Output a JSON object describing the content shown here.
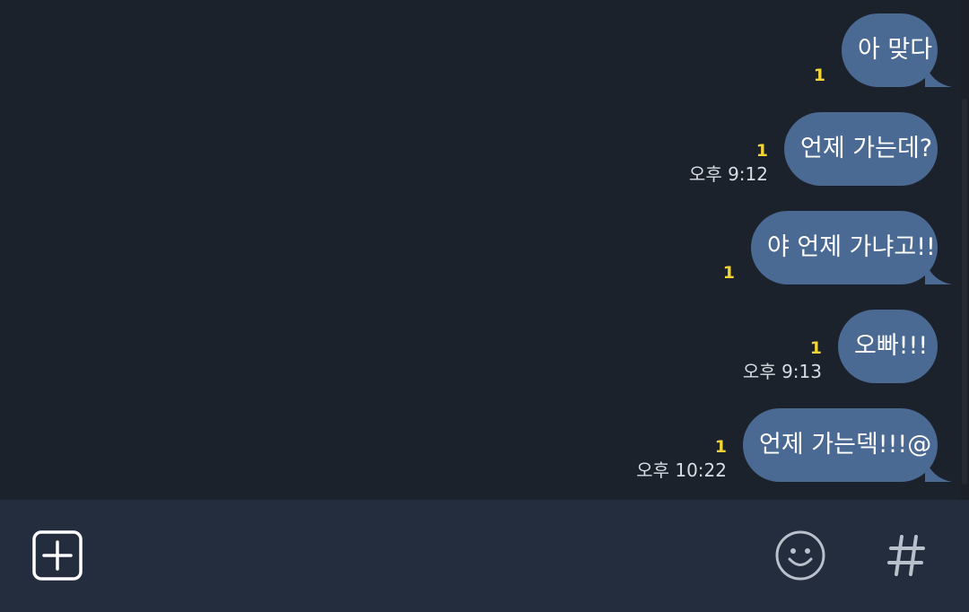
{
  "messages": [
    {
      "text": "아 맞다",
      "unread": "1",
      "time": ""
    },
    {
      "text": "언제 가는데?",
      "unread": "1",
      "time": "오후 9:12"
    },
    {
      "text": "야 언제 가냐고!!",
      "unread": "1",
      "time": ""
    },
    {
      "text": "오빠!!!",
      "unread": "1",
      "time": "오후 9:13"
    },
    {
      "text": "언제 가는덱!!!@",
      "unread": "1",
      "time": "오후 10:22"
    }
  ],
  "input_bar": {
    "plus_icon": "plus-square-icon",
    "emoji_icon": "smiley-icon",
    "hash_icon": "hash-icon"
  },
  "colors": {
    "background": "#1c222c",
    "bubble": "#4a6993",
    "unread": "#f3d437",
    "input_bar": "#232d3d"
  }
}
